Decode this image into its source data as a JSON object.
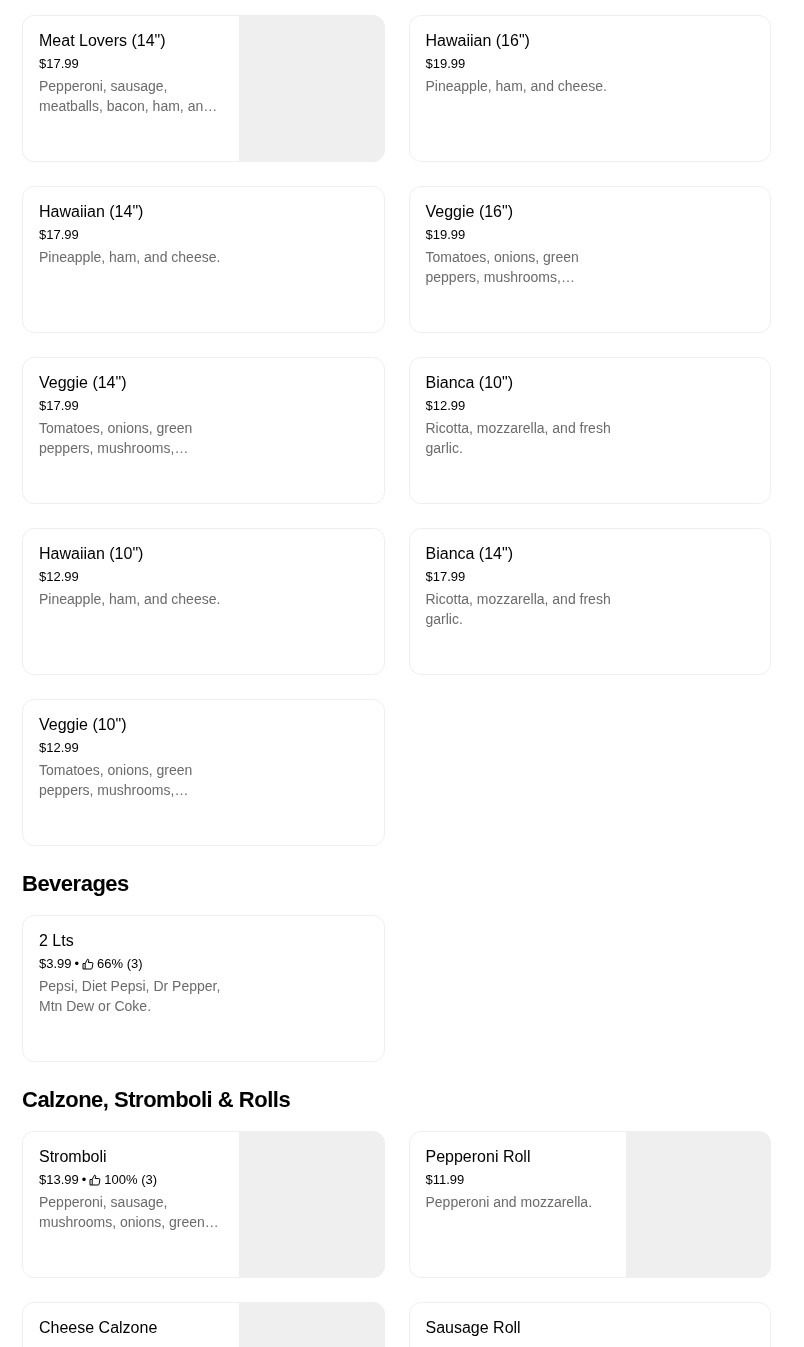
{
  "sections": [
    {
      "items": [
        {
          "title": "Meat Lovers (14\")",
          "price": "$17.99",
          "description": "Pepperoni, sausage, meatballs, bacon, ham, an…",
          "has_image": true
        },
        {
          "title": "Hawaiian (16\")",
          "price": "$19.99",
          "description": "Pineapple, ham, and cheese.",
          "has_image": false
        },
        {
          "title": "Hawaiian (14\")",
          "price": "$17.99",
          "description": "Pineapple, ham, and cheese.",
          "has_image": false
        },
        {
          "title": "Veggie (16\")",
          "price": "$19.99",
          "description": "Tomatoes, onions, green peppers, mushrooms,…",
          "has_image": false
        },
        {
          "title": "Veggie (14\")",
          "price": "$17.99",
          "description": "Tomatoes, onions, green peppers, mushrooms,…",
          "has_image": false
        },
        {
          "title": "Bianca (10\")",
          "price": "$12.99",
          "description": "Ricotta, mozzarella, and fresh garlic.",
          "has_image": false
        },
        {
          "title": "Hawaiian (10\")",
          "price": "$12.99",
          "description": "Pineapple, ham, and cheese.",
          "has_image": false
        },
        {
          "title": "Bianca (14\")",
          "price": "$17.99",
          "description": "Ricotta, mozzarella, and fresh garlic.",
          "has_image": false
        },
        {
          "title": "Veggie (10\")",
          "price": "$12.99",
          "description": "Tomatoes, onions, green peppers, mushrooms,…",
          "has_image": false
        }
      ]
    },
    {
      "title": "Beverages",
      "items": [
        {
          "title": "2 Lts",
          "price": "$3.99",
          "rating": {
            "separator": "•",
            "text": "66% (3)"
          },
          "description": "Pepsi, Diet Pepsi, Dr Pepper, Mtn Dew or Coke.",
          "has_image": false
        }
      ]
    },
    {
      "title": "Calzone, Stromboli & Rolls",
      "items": [
        {
          "title": "Stromboli",
          "price": "$13.99",
          "rating": {
            "separator": "•",
            "text": "100% (3)"
          },
          "description": "Pepperoni, sausage, mushrooms, onions, green…",
          "has_image": true
        },
        {
          "title": "Pepperoni Roll",
          "price": "$11.99",
          "description": "Pepperoni and mozzarella.",
          "has_image": true
        },
        {
          "title": "Cheese Calzone",
          "has_image": true
        },
        {
          "title": "Sausage Roll",
          "has_image": false
        }
      ]
    }
  ]
}
